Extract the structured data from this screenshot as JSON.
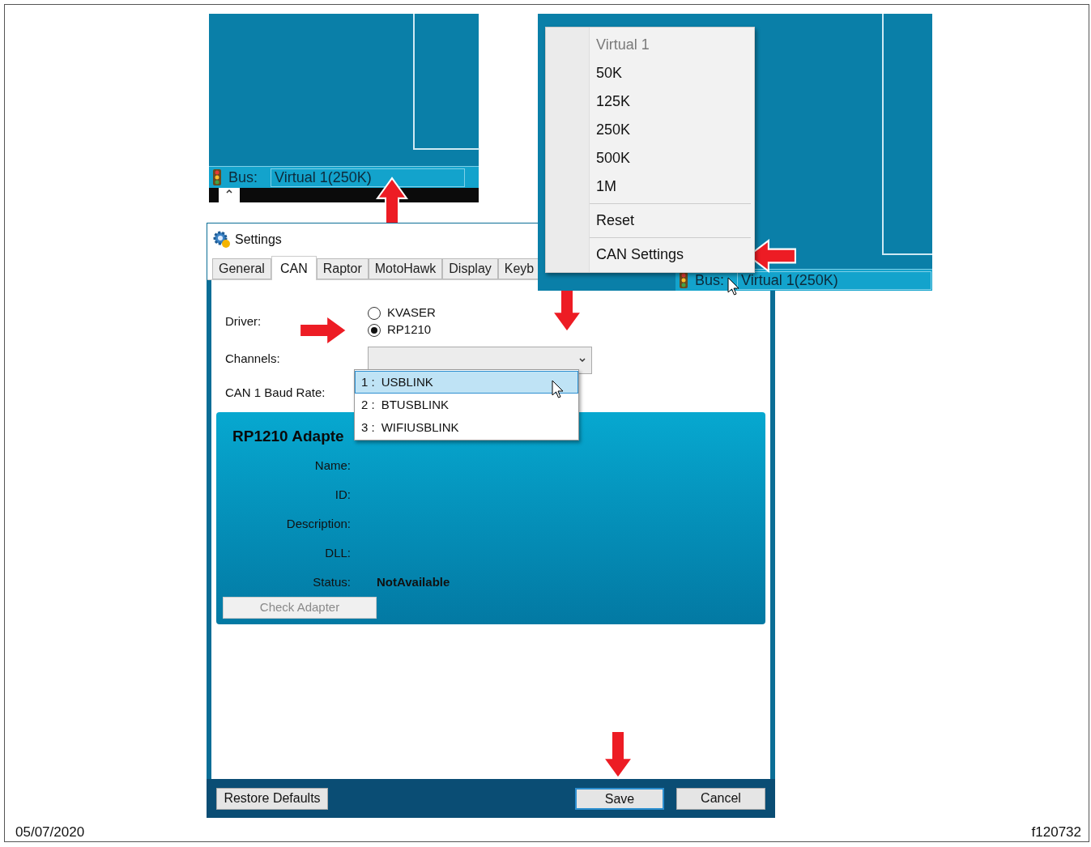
{
  "status_inset": {
    "bus_label": "Bus:",
    "bus_value": "Virtual 1(250K)"
  },
  "menu_inset": {
    "groups": [
      [
        {
          "label": "Virtual 1",
          "disabled": true
        },
        {
          "label": "50K",
          "disabled": false
        },
        {
          "label": "125K",
          "disabled": false
        },
        {
          "label": "250K",
          "disabled": false
        },
        {
          "label": "500K",
          "disabled": false
        },
        {
          "label": "1M",
          "disabled": false
        }
      ],
      [
        {
          "label": "Reset",
          "disabled": false
        }
      ],
      [
        {
          "label": "CAN Settings",
          "disabled": false
        }
      ]
    ],
    "bus_label": "Bus:",
    "bus_value": "Virtual 1(250K)"
  },
  "settings_dialog": {
    "title": "Settings",
    "tabs": [
      {
        "label": "General",
        "selected": false
      },
      {
        "label": "CAN",
        "selected": true
      },
      {
        "label": "Raptor",
        "selected": false
      },
      {
        "label": "MotoHawk",
        "selected": false
      },
      {
        "label": "Display",
        "selected": false
      },
      {
        "label": "Keyb",
        "selected": false
      }
    ],
    "driver_label": "Driver:",
    "drivers": [
      {
        "label": "KVASER",
        "selected": false
      },
      {
        "label": "RP1210",
        "selected": true
      }
    ],
    "channels_label": "Channels:",
    "baud_label": "CAN 1 Baud Rate:",
    "channel_options": [
      {
        "number": "1 :",
        "label": "USBLINK",
        "selected": true
      },
      {
        "number": "2 :",
        "label": "BTUSBLINK",
        "selected": false
      },
      {
        "number": "3 :",
        "label": "WIFIUSBLINK",
        "selected": false
      }
    ],
    "adapter_panel": {
      "title": "RP1210 Adapte",
      "fields": [
        {
          "label": "Name:"
        },
        {
          "label": "ID:"
        },
        {
          "label": "Description:"
        },
        {
          "label": "DLL:"
        },
        {
          "label": "Status:",
          "value": "NotAvailable"
        }
      ],
      "check_button": {
        "label": "Check Adapter",
        "disabled": true
      }
    },
    "buttons": {
      "restore": "Restore Defaults",
      "save": "Save",
      "cancel": "Cancel"
    }
  },
  "footer": {
    "date": "05/07/2020",
    "figure_id": "f120732"
  }
}
